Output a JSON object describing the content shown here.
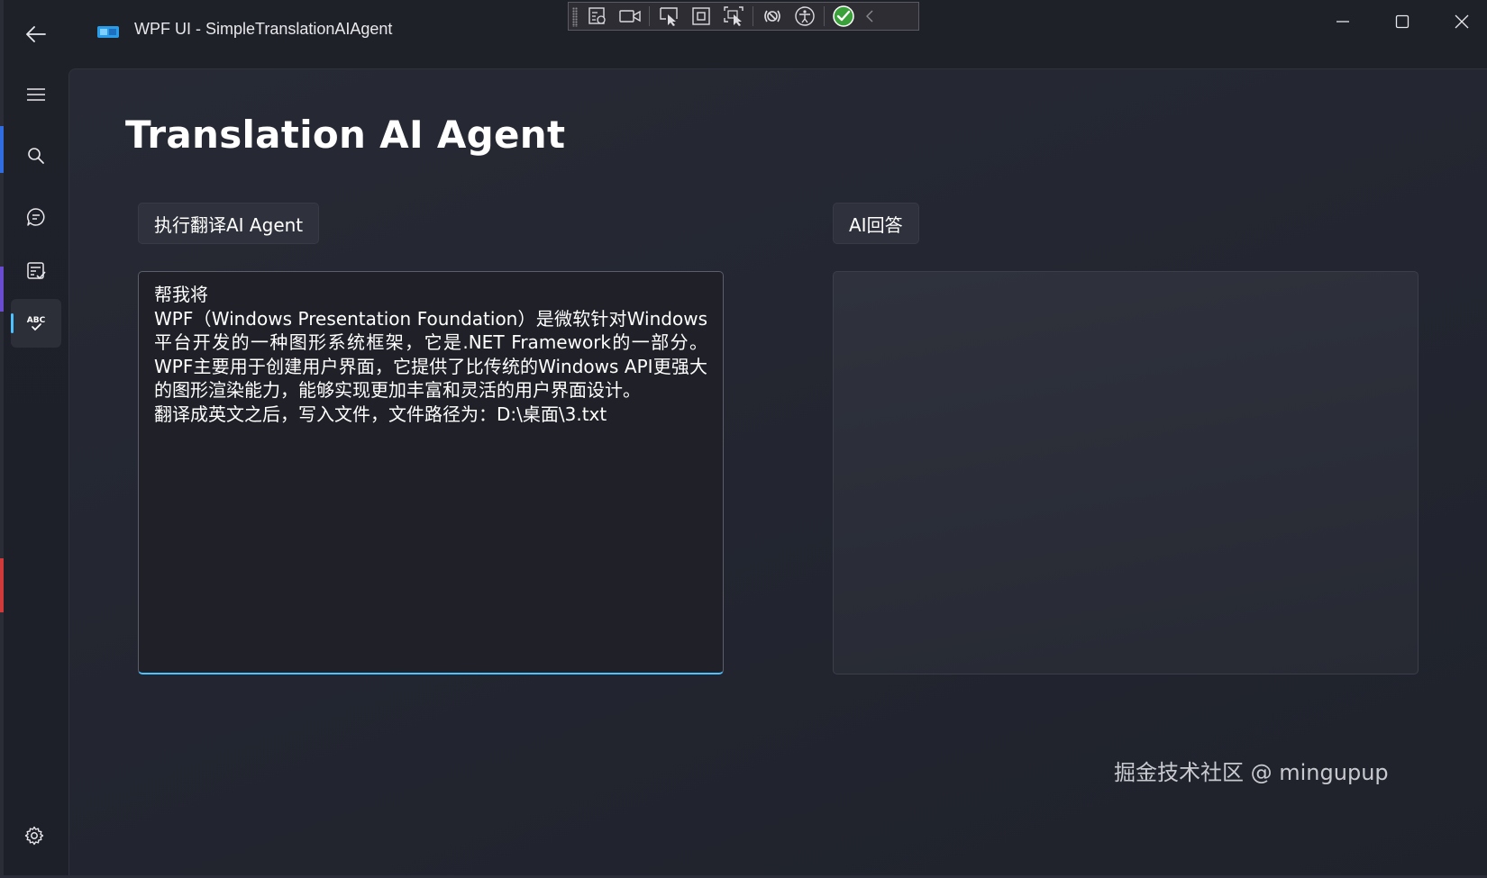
{
  "window": {
    "title": "WPF UI - SimpleTranslationAIAgent"
  },
  "page": {
    "title": "Translation AI Agent"
  },
  "buttons": {
    "run_agent": "执行翻译AI Agent",
    "ai_answer": "AI回答"
  },
  "input": {
    "value": "帮我将\nWPF（Windows Presentation Foundation）是微软针对Windows平台开发的一种图形系统框架，它是.NET Framework的一部分。WPF主要用于创建用户界面，它提供了比传统的Windows API更强大的图形渲染能力，能够实现更加丰富和灵活的用户界面设计。\n翻译成英文之后，写入文件，文件路径为：D:\\桌面\\3.txt"
  },
  "output": {
    "value": ""
  },
  "sidebar": {
    "items": [
      {
        "icon": "hamburger-menu-icon"
      },
      {
        "icon": "search-icon"
      },
      {
        "icon": "chat-icon"
      },
      {
        "icon": "task-list-icon"
      },
      {
        "icon": "spellcheck-abc-icon",
        "label": "ABC",
        "active": true
      }
    ],
    "footer_icon": "gear-icon"
  },
  "debug_toolbar": {
    "icons": [
      "live-visual-tree-icon",
      "record-icon",
      "select-element-icon",
      "display-layout-adorners-icon",
      "track-focus-icon",
      "binding-failures-icon",
      "accessibility-icon",
      "hot-reload-check-icon",
      "collapse-chevron-icon"
    ]
  },
  "watermark": "掘金技术社区 @ mingupup",
  "colors": {
    "accent": "#4cc2ff",
    "background": "#1f2129",
    "card": "#272a34",
    "hot_reload_ok": "#3aa03a"
  }
}
